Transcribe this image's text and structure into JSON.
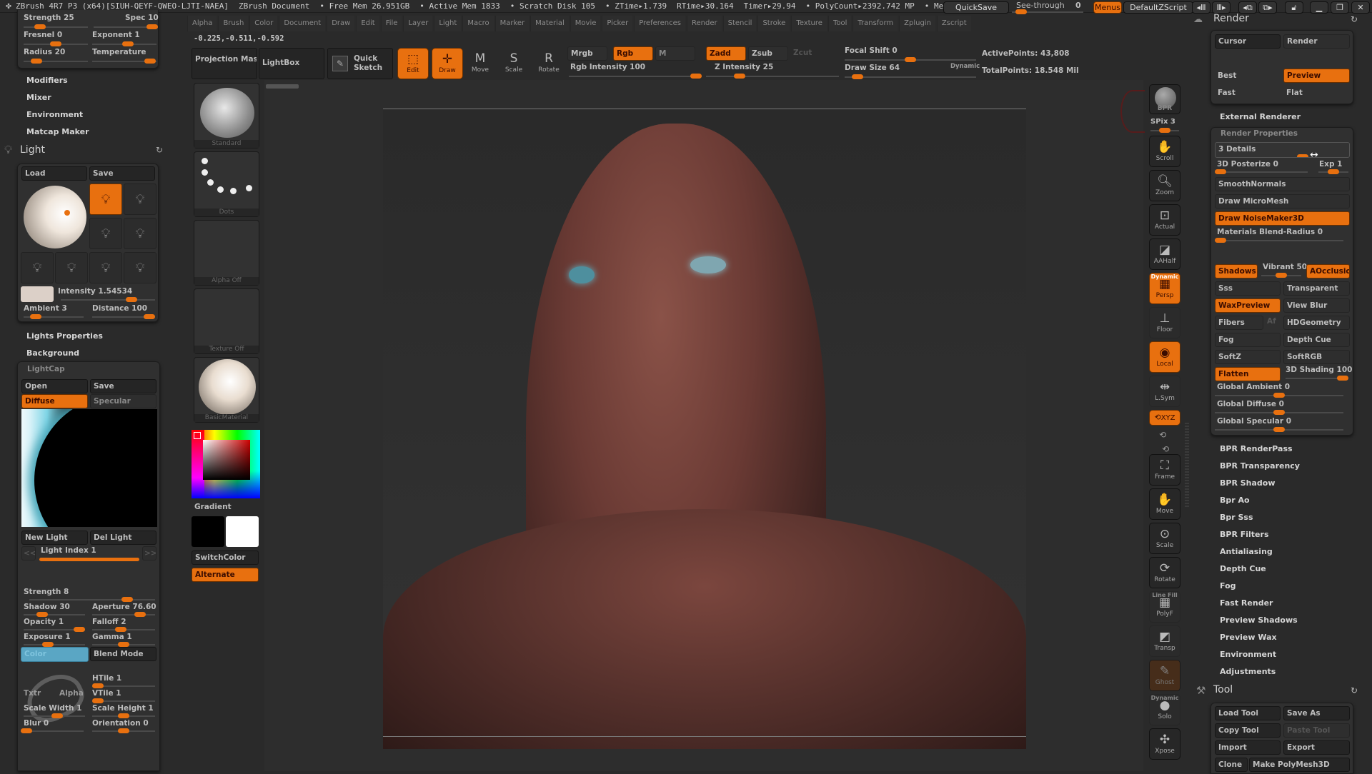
{
  "titlebar": {
    "app": "ZBrush 4R7 P3 (x64)[SIUH-QEYF-QWEO-LJTI-NAEA]",
    "document": "ZBrush Document",
    "free_mem": "• Free Mem 26.951GB",
    "active_mem": "• Active Mem 1833",
    "scratch": "• Scratch Disk 105",
    "ztime": "• ZTime▸1.739",
    "rtime": "RTime▸30.164",
    "timer": "Timer▸29.94",
    "polycount": "• PolyCount▸2392.742 MP",
    "meshc": "• MeshC",
    "quicksave": "QuickSave",
    "see_through_label": "See-through",
    "see_through_value": "0",
    "see_through_fraction": 0.05,
    "menus": "Menus",
    "script": "DefaultZScript",
    "window_buttons": [
      "prev-icon",
      "next-icon",
      "palette-left-icon",
      "palette-right-icon",
      "lock-icon",
      "minimize-icon",
      "restore-icon",
      "close-icon"
    ]
  },
  "menubar": [
    "Alpha",
    "Brush",
    "Color",
    "Document",
    "Draw",
    "Edit",
    "File",
    "Layer",
    "Light",
    "Macro",
    "Marker",
    "Material",
    "Movie",
    "Picker",
    "Preferences",
    "Render",
    "Stencil",
    "Stroke",
    "Texture",
    "Tool",
    "Transform",
    "Zplugin",
    "Zscript"
  ],
  "coords": "-0.225,-0.511,-0.592",
  "toolbar": {
    "projection_master": "Projection Master",
    "lightbox": "LightBox",
    "quick_sketch": "Quick Sketch",
    "edit": "Edit",
    "draw": "Draw",
    "move": "Move",
    "scale": "Scale",
    "rotate": "Rotate",
    "mrgb": "Mrgb",
    "rgb": "Rgb",
    "m": "M",
    "rgb_intensity": "Rgb Intensity 100",
    "rgb_intensity_fraction": 1.0,
    "zadd": "Zadd",
    "zsub": "Zsub",
    "zcut": "Zcut",
    "z_intensity": "Z Intensity 25",
    "z_intensity_fraction": 0.25,
    "focal_shift": "Focal Shift 0",
    "focal_shift_fraction": 0.5,
    "draw_size": "Draw Size 64",
    "draw_size_fraction": 0.1,
    "dynamic": "Dynamic",
    "active_points": "ActivePoints: 43,808",
    "total_points": "TotalPoints: 18.548 Mil"
  },
  "left_panel": {
    "material_top": {
      "strength": "Strength 25",
      "strength_fraction": 0.25,
      "spec": "Spec 10",
      "spec_fraction": 0.95,
      "fresnel": "Fresnel 0",
      "fresnel_fraction": 0.5,
      "exponent": "Exponent 1",
      "exponent_fraction": 0.55,
      "radius": "Radius 20",
      "radius_fraction": 0.2,
      "temperature": "Temperature",
      "temperature_fraction": 0.9
    },
    "submenus": [
      "Modifiers",
      "Mixer",
      "Environment",
      "Matcap Maker"
    ],
    "light": {
      "title": "Light",
      "load": "Load",
      "save": "Save",
      "intensity": "Intensity 1.54534",
      "intensity_fraction": 0.75,
      "ambient": "Ambient 3",
      "ambient_fraction": 0.2,
      "distance": "Distance 100",
      "distance_fraction": 0.98
    },
    "light_submenus": [
      "Lights Properties",
      "Background"
    ],
    "lightcap": {
      "title": "LightCap",
      "open": "Open",
      "save": "Save",
      "diffuse": "Diffuse",
      "specular": "Specular",
      "new_light": "New Light",
      "del_light": "Del Light",
      "prev": "<<",
      "next": ">>",
      "light_index": "Light Index 1",
      "strength": "Strength 8",
      "strength_fraction": 0.78,
      "shadow": "Shadow 30",
      "shadow_fraction": 0.3,
      "aperture": "Aperture 76.60",
      "aperture_fraction": 0.76,
      "opacity": "Opacity 1",
      "opacity_fraction": 0.95,
      "falloff": "Falloff 2",
      "falloff_fraction": 0.45,
      "exposure": "Exposure 1",
      "exposure_fraction": 0.4,
      "gamma": "Gamma 1",
      "gamma_fraction": 0.5,
      "color_label": "Color",
      "blend_mode": "Blend Mode",
      "htile": "HTile 1",
      "htile_fraction": 0.05,
      "vtile": "VTile 1",
      "vtile_fraction": 0.05,
      "txtr": "Txtr",
      "alpha": "Alpha",
      "scale_width": "Scale Width 1",
      "scale_width_fraction": 0.55,
      "scale_height": "Scale Height 1",
      "scale_height_fraction": 0.5,
      "blur": "Blur 0",
      "blur_fraction": 0.03,
      "orientation": "Orientation 0",
      "orientation_fraction": 0.5
    }
  },
  "shelf": {
    "brush": "Standard",
    "stroke": "Dots",
    "alpha": "Alpha Off",
    "texture": "Texture Off",
    "material": "BasicMaterial",
    "gradient": "Gradient",
    "switch_color": "SwitchColor",
    "alternate": "Alternate",
    "main_color": "#cc0000"
  },
  "right_shelf": {
    "bpr": "BPR",
    "spix": "SPix 3",
    "buttons": [
      {
        "label": "Scroll",
        "icon": "hand-scroll-icon",
        "active": false
      },
      {
        "label": "Zoom",
        "icon": "zoom-icon",
        "active": false
      },
      {
        "label": "Actual",
        "icon": "actual-size-icon",
        "active": false
      },
      {
        "label": "AAHalf",
        "icon": "aahalf-icon",
        "active": false
      },
      {
        "label": "Persp",
        "icon": "perspective-icon",
        "active": true,
        "top": "Dynamic"
      },
      {
        "label": "Floor",
        "icon": "floor-icon",
        "active": false
      },
      {
        "label": "Local",
        "icon": "local-icon",
        "active": true
      },
      {
        "label": "L.Sym",
        "icon": "local-symmetry-icon",
        "active": false
      },
      {
        "label": "XYZ",
        "icon": "xyz-rotate-icon",
        "active": true
      },
      {
        "label": "Frame",
        "icon": "frame-icon",
        "active": false
      },
      {
        "label": "Move",
        "icon": "move-icon",
        "active": false
      },
      {
        "label": "Scale",
        "icon": "scale-icon",
        "active": false
      },
      {
        "label": "Rotate",
        "icon": "rotate-icon",
        "active": false
      },
      {
        "label": "PolyF",
        "icon": "polyframe-icon",
        "active": false,
        "top": "Line Fill"
      },
      {
        "label": "Transp",
        "icon": "transparency-icon",
        "active": false
      },
      {
        "label": "Ghost",
        "icon": "ghost-icon",
        "active": false
      },
      {
        "label": "Solo",
        "icon": "solo-icon",
        "active": false,
        "top": "Dynamic"
      },
      {
        "label": "Xpose",
        "icon": "xpose-icon",
        "active": false
      }
    ]
  },
  "render_palette": {
    "title": "Render",
    "cursor": "Cursor",
    "render": "Render",
    "best": "Best",
    "preview": "Preview",
    "fast": "Fast",
    "flat": "Flat",
    "external_renderer": "External Renderer",
    "render_properties": "Render Properties",
    "details": "3 Details",
    "details_fraction": 0.6,
    "posterize": "3D Posterize 0",
    "posterize_fraction": 0.0,
    "exp": "Exp 1",
    "exp_fraction": 0.5,
    "smooth_normals": "SmoothNormals",
    "draw_micromesh": "Draw MicroMesh",
    "draw_noisemaker": "Draw NoiseMaker3D",
    "materials_blend": "Materials Blend-Radius 0",
    "materials_blend_fraction": 0.0,
    "shadows": "Shadows",
    "vibrant": "Vibrant 50",
    "vibrant_fraction": 0.5,
    "aocclusion": "AOcclusion",
    "sss": "Sss",
    "transparent": "Transparent",
    "waxpreview": "WaxPreview",
    "view_blur": "View Blur",
    "fibers": "Fibers",
    "af": "Af",
    "hdgeometry": "HDGeometry",
    "fog": "Fog",
    "depth_cue": "Depth Cue",
    "softz": "SoftZ",
    "softrgb": "SoftRGB",
    "flatten": "Flatten",
    "shading": "3D Shading 100",
    "shading_fraction": 1.0,
    "global_ambient": "Global Ambient 0",
    "global_ambient_fraction": 0.5,
    "global_diffuse": "Global Diffuse 0",
    "global_diffuse_fraction": 0.5,
    "global_specular": "Global Specular 0",
    "global_specular_fraction": 0.5,
    "submenus": [
      "BPR RenderPass",
      "BPR Transparency",
      "BPR Shadow",
      "Bpr Ao",
      "Bpr Sss",
      "BPR Filters",
      "Antialiasing",
      "Depth Cue",
      "Fog",
      "Fast Render",
      "Preview Shadows",
      "Preview Wax",
      "Environment",
      "Adjustments"
    ]
  },
  "tool_palette": {
    "title": "Tool",
    "load_tool": "Load Tool",
    "save_as": "Save As",
    "copy_tool": "Copy Tool",
    "paste_tool": "Paste Tool",
    "import": "Import",
    "export": "Export",
    "clone": "Clone",
    "make_polymesh": "Make PolyMesh3D"
  },
  "colors": {
    "accent": "#e8700f",
    "background": "#2a2a2a",
    "panel": "#303030"
  }
}
